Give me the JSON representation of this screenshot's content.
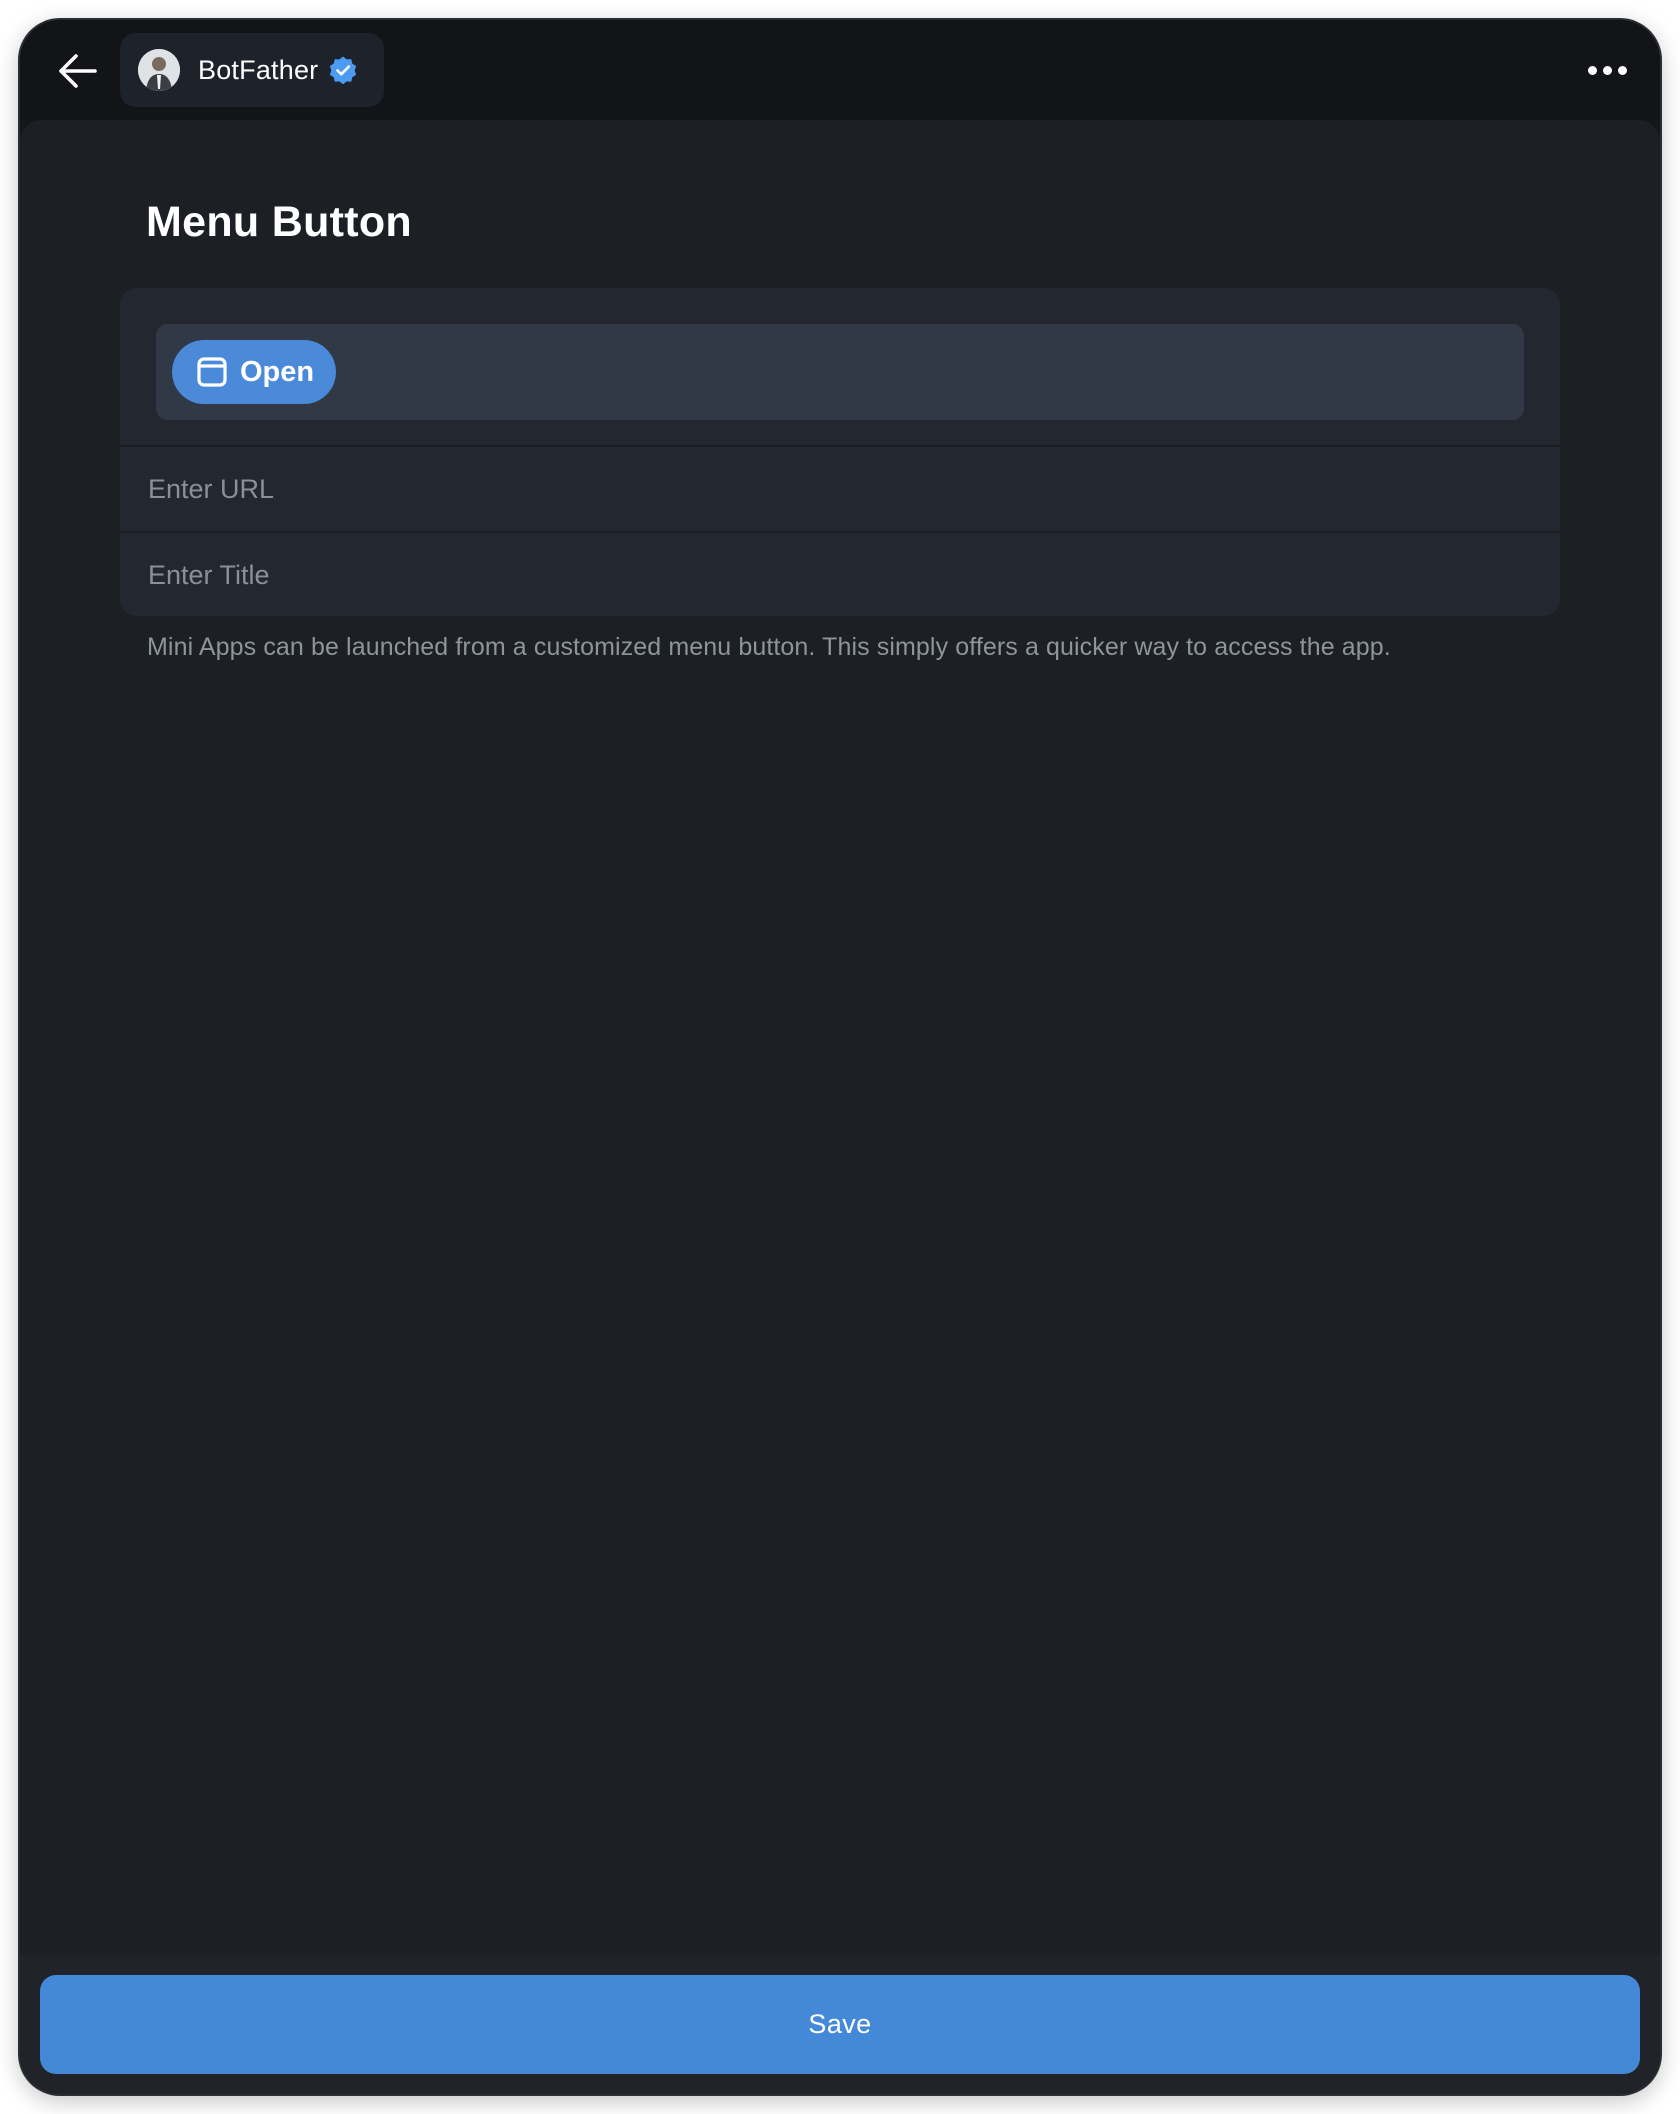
{
  "header": {
    "back_icon": "arrow-left-icon",
    "bot_name": "BotFather",
    "verified_icon": "verified-badge-icon",
    "more_icon": "more-horizontal-icon"
  },
  "page": {
    "title": "Menu Button"
  },
  "preview": {
    "button_icon": "window-icon",
    "button_label": "Open"
  },
  "form": {
    "url_placeholder": "Enter URL",
    "url_value": "",
    "title_placeholder": "Enter Title",
    "title_value": "",
    "hint": "Mini Apps can be launched from a customized menu button. This simply offers a quicker way to access the app."
  },
  "footer": {
    "save_label": "Save"
  },
  "colors": {
    "accent": "#4489d8",
    "background": "#1c1f23",
    "card": "#232730",
    "verified": "#4b9cf0"
  }
}
